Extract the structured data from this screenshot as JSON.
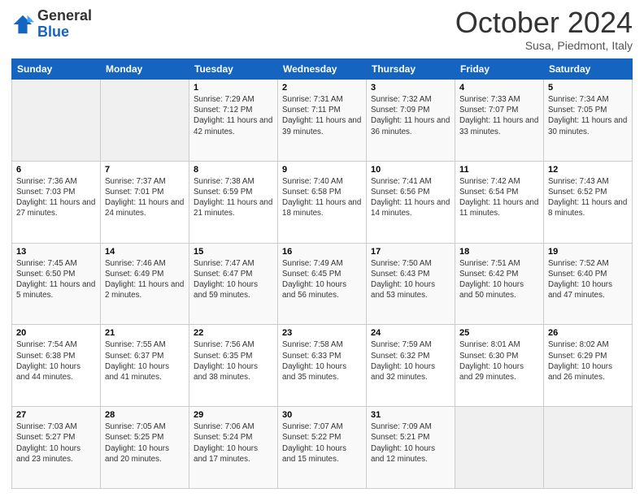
{
  "header": {
    "logo_general": "General",
    "logo_blue": "Blue",
    "month_title": "October 2024",
    "location": "Susa, Piedmont, Italy"
  },
  "weekdays": [
    "Sunday",
    "Monday",
    "Tuesday",
    "Wednesday",
    "Thursday",
    "Friday",
    "Saturday"
  ],
  "weeks": [
    [
      {
        "day": "",
        "sunrise": "",
        "sunset": "",
        "daylight": ""
      },
      {
        "day": "",
        "sunrise": "",
        "sunset": "",
        "daylight": ""
      },
      {
        "day": "1",
        "sunrise": "Sunrise: 7:29 AM",
        "sunset": "Sunset: 7:12 PM",
        "daylight": "Daylight: 11 hours and 42 minutes."
      },
      {
        "day": "2",
        "sunrise": "Sunrise: 7:31 AM",
        "sunset": "Sunset: 7:11 PM",
        "daylight": "Daylight: 11 hours and 39 minutes."
      },
      {
        "day": "3",
        "sunrise": "Sunrise: 7:32 AM",
        "sunset": "Sunset: 7:09 PM",
        "daylight": "Daylight: 11 hours and 36 minutes."
      },
      {
        "day": "4",
        "sunrise": "Sunrise: 7:33 AM",
        "sunset": "Sunset: 7:07 PM",
        "daylight": "Daylight: 11 hours and 33 minutes."
      },
      {
        "day": "5",
        "sunrise": "Sunrise: 7:34 AM",
        "sunset": "Sunset: 7:05 PM",
        "daylight": "Daylight: 11 hours and 30 minutes."
      }
    ],
    [
      {
        "day": "6",
        "sunrise": "Sunrise: 7:36 AM",
        "sunset": "Sunset: 7:03 PM",
        "daylight": "Daylight: 11 hours and 27 minutes."
      },
      {
        "day": "7",
        "sunrise": "Sunrise: 7:37 AM",
        "sunset": "Sunset: 7:01 PM",
        "daylight": "Daylight: 11 hours and 24 minutes."
      },
      {
        "day": "8",
        "sunrise": "Sunrise: 7:38 AM",
        "sunset": "Sunset: 6:59 PM",
        "daylight": "Daylight: 11 hours and 21 minutes."
      },
      {
        "day": "9",
        "sunrise": "Sunrise: 7:40 AM",
        "sunset": "Sunset: 6:58 PM",
        "daylight": "Daylight: 11 hours and 18 minutes."
      },
      {
        "day": "10",
        "sunrise": "Sunrise: 7:41 AM",
        "sunset": "Sunset: 6:56 PM",
        "daylight": "Daylight: 11 hours and 14 minutes."
      },
      {
        "day": "11",
        "sunrise": "Sunrise: 7:42 AM",
        "sunset": "Sunset: 6:54 PM",
        "daylight": "Daylight: 11 hours and 11 minutes."
      },
      {
        "day": "12",
        "sunrise": "Sunrise: 7:43 AM",
        "sunset": "Sunset: 6:52 PM",
        "daylight": "Daylight: 11 hours and 8 minutes."
      }
    ],
    [
      {
        "day": "13",
        "sunrise": "Sunrise: 7:45 AM",
        "sunset": "Sunset: 6:50 PM",
        "daylight": "Daylight: 11 hours and 5 minutes."
      },
      {
        "day": "14",
        "sunrise": "Sunrise: 7:46 AM",
        "sunset": "Sunset: 6:49 PM",
        "daylight": "Daylight: 11 hours and 2 minutes."
      },
      {
        "day": "15",
        "sunrise": "Sunrise: 7:47 AM",
        "sunset": "Sunset: 6:47 PM",
        "daylight": "Daylight: 10 hours and 59 minutes."
      },
      {
        "day": "16",
        "sunrise": "Sunrise: 7:49 AM",
        "sunset": "Sunset: 6:45 PM",
        "daylight": "Daylight: 10 hours and 56 minutes."
      },
      {
        "day": "17",
        "sunrise": "Sunrise: 7:50 AM",
        "sunset": "Sunset: 6:43 PM",
        "daylight": "Daylight: 10 hours and 53 minutes."
      },
      {
        "day": "18",
        "sunrise": "Sunrise: 7:51 AM",
        "sunset": "Sunset: 6:42 PM",
        "daylight": "Daylight: 10 hours and 50 minutes."
      },
      {
        "day": "19",
        "sunrise": "Sunrise: 7:52 AM",
        "sunset": "Sunset: 6:40 PM",
        "daylight": "Daylight: 10 hours and 47 minutes."
      }
    ],
    [
      {
        "day": "20",
        "sunrise": "Sunrise: 7:54 AM",
        "sunset": "Sunset: 6:38 PM",
        "daylight": "Daylight: 10 hours and 44 minutes."
      },
      {
        "day": "21",
        "sunrise": "Sunrise: 7:55 AM",
        "sunset": "Sunset: 6:37 PM",
        "daylight": "Daylight: 10 hours and 41 minutes."
      },
      {
        "day": "22",
        "sunrise": "Sunrise: 7:56 AM",
        "sunset": "Sunset: 6:35 PM",
        "daylight": "Daylight: 10 hours and 38 minutes."
      },
      {
        "day": "23",
        "sunrise": "Sunrise: 7:58 AM",
        "sunset": "Sunset: 6:33 PM",
        "daylight": "Daylight: 10 hours and 35 minutes."
      },
      {
        "day": "24",
        "sunrise": "Sunrise: 7:59 AM",
        "sunset": "Sunset: 6:32 PM",
        "daylight": "Daylight: 10 hours and 32 minutes."
      },
      {
        "day": "25",
        "sunrise": "Sunrise: 8:01 AM",
        "sunset": "Sunset: 6:30 PM",
        "daylight": "Daylight: 10 hours and 29 minutes."
      },
      {
        "day": "26",
        "sunrise": "Sunrise: 8:02 AM",
        "sunset": "Sunset: 6:29 PM",
        "daylight": "Daylight: 10 hours and 26 minutes."
      }
    ],
    [
      {
        "day": "27",
        "sunrise": "Sunrise: 7:03 AM",
        "sunset": "Sunset: 5:27 PM",
        "daylight": "Daylight: 10 hours and 23 minutes."
      },
      {
        "day": "28",
        "sunrise": "Sunrise: 7:05 AM",
        "sunset": "Sunset: 5:25 PM",
        "daylight": "Daylight: 10 hours and 20 minutes."
      },
      {
        "day": "29",
        "sunrise": "Sunrise: 7:06 AM",
        "sunset": "Sunset: 5:24 PM",
        "daylight": "Daylight: 10 hours and 17 minutes."
      },
      {
        "day": "30",
        "sunrise": "Sunrise: 7:07 AM",
        "sunset": "Sunset: 5:22 PM",
        "daylight": "Daylight: 10 hours and 15 minutes."
      },
      {
        "day": "31",
        "sunrise": "Sunrise: 7:09 AM",
        "sunset": "Sunset: 5:21 PM",
        "daylight": "Daylight: 10 hours and 12 minutes."
      },
      {
        "day": "",
        "sunrise": "",
        "sunset": "",
        "daylight": ""
      },
      {
        "day": "",
        "sunrise": "",
        "sunset": "",
        "daylight": ""
      }
    ]
  ]
}
